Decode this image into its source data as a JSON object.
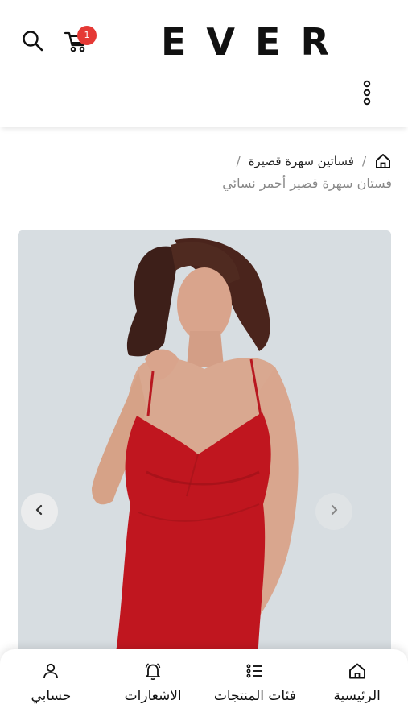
{
  "header": {
    "logo": "EVER",
    "cart_count": "1"
  },
  "breadcrumb": {
    "category": "فساتين سهرة قصيرة",
    "separator": "/",
    "current": "فستان سهرة قصير أحمر نسائي"
  },
  "gallery": {
    "background_color": "#d7dde1",
    "dress_color": "#c0161f"
  },
  "bottom_nav": {
    "home": "الرئيسية",
    "categories": "فئات المنتجات",
    "notifications": "الاشعارات",
    "account": "حسابي"
  },
  "colors": {
    "badge": "#e53935",
    "text": "#111111",
    "muted": "#888888"
  }
}
